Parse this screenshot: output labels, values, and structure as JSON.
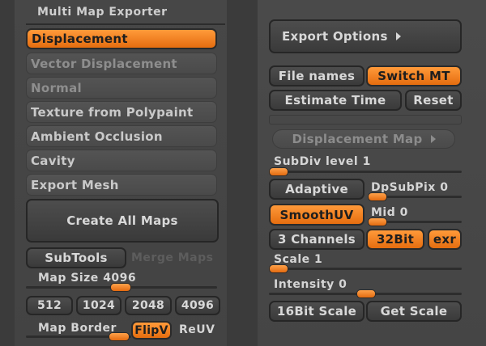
{
  "left": {
    "title": "Multi Map Exporter",
    "maps": [
      {
        "label": "Displacement",
        "active": true
      },
      {
        "label": "Vector Displacement",
        "active": false
      },
      {
        "label": "Normal",
        "active": false
      },
      {
        "label": "Texture from Polypaint",
        "active": false
      },
      {
        "label": "Ambient Occlusion",
        "active": false
      },
      {
        "label": "Cavity",
        "active": false
      },
      {
        "label": "Export Mesh",
        "active": false
      }
    ],
    "create_all_maps": "Create All Maps",
    "subtools": "SubTools",
    "merge_maps": "Merge Maps",
    "map_size_label": "Map Size",
    "map_size_value": "4096",
    "map_size_fraction": 0.55,
    "size_buttons": [
      "512",
      "1024",
      "2048",
      "4096"
    ],
    "map_border_label": "Map Border",
    "map_border_fraction": 0.9,
    "flipv": "FlipV",
    "reuv": "ReUV"
  },
  "right": {
    "export_options": "Export Options",
    "file_names": "File names",
    "switch_mt": "Switch MT",
    "estimate_time": "Estimate Time",
    "reset": "Reset",
    "displacement_map": "Displacement Map",
    "subdiv_label": "SubDiv level",
    "subdiv_value": "1",
    "adaptive": "Adaptive",
    "dpsubpix_label": "DpSubPix",
    "dpsubpix_value": "0",
    "smoothuv": "SmoothUV",
    "mid_label": "Mid",
    "mid_value": "0",
    "channels": "3 Channels",
    "bit32": "32Bit",
    "exr": "exr",
    "scale_label": "Scale",
    "scale_value": "1",
    "intensity_label": "Intensity",
    "intensity_value": "0",
    "bit16_scale": "16Bit Scale",
    "get_scale": "Get Scale"
  },
  "colors": {
    "accent": "#f0801f",
    "background": "#3b3b3b",
    "text": "#d8d8d8"
  }
}
